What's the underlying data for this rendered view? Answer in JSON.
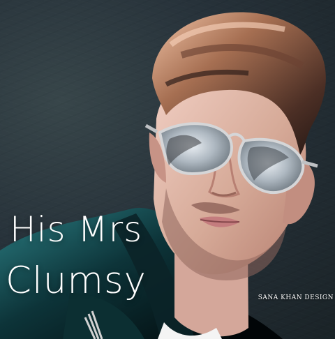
{
  "cover": {
    "title_line_1": "His Mrs",
    "title_line_2": "Clumsy",
    "designer_credit": "SANA KHAN DESIGN"
  },
  "palette": {
    "background": "#27323a",
    "jacket": "#17454a",
    "hair": "#8a6751",
    "skin": "#d9b3a5",
    "text": "#ffffff"
  }
}
